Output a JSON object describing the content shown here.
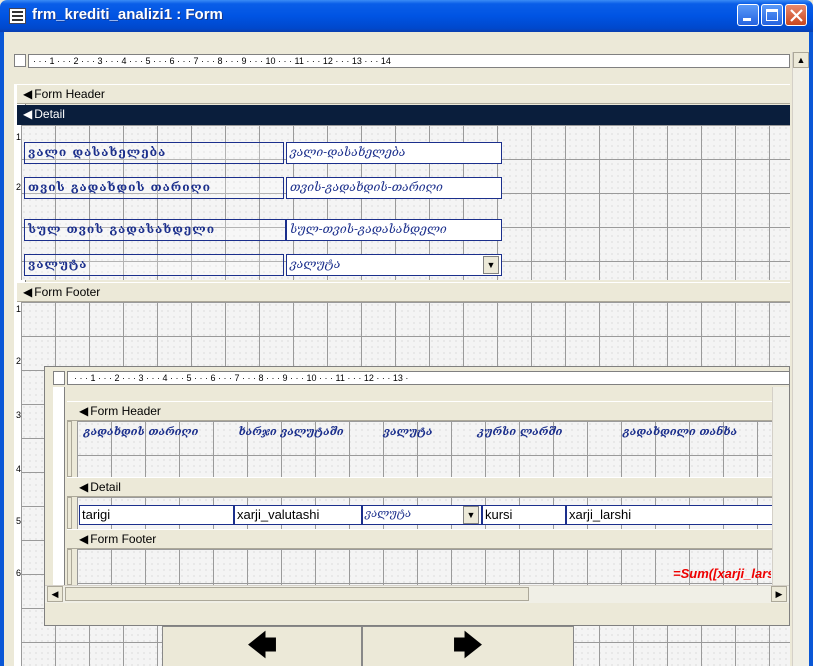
{
  "window": {
    "title": "frm_krediti_analizi1 : Form"
  },
  "ruler": {
    "top_ticks": "· · · 1 · · · 2 · · · 3 · · · 4 · · · 5 · · · 6 · · · 7 · · · 8 · · · 9 · · · 10 · · · 11 · · · 12 · · · 13 · · · 14",
    "sub_ticks": "· · · 1 · · · 2 · · · 3 · · · 4 · · · 5 · · · 6 · · · 7 · · · 8 · · · 9 · · · 10 · · · 11 · · · 12 · · · 13 ·",
    "left_numbers": [
      "1",
      "2",
      "1",
      "2",
      "3",
      "4",
      "5",
      "6"
    ]
  },
  "main_form": {
    "form_header": "Form Header",
    "detail": "Detail",
    "form_footer": "Form Footer",
    "rows": [
      {
        "label": "ვალი დასახელება",
        "value": "ვალი-დასახელება"
      },
      {
        "label": "თვის გადახდის თარიღი",
        "value": "თვის-გადახდის-თარიღი"
      },
      {
        "label": "სულ თვის გადასახდელი",
        "value": "სულ-თვის-გადასახდელი"
      },
      {
        "label": "ვალუტა",
        "value": "ვალუტა"
      }
    ]
  },
  "subform": {
    "form_header": "Form Header",
    "detail": "Detail",
    "form_footer": "Form Footer",
    "headers": [
      "გადახდის თარიღი",
      "ხარჯი ვალუტაში",
      "ვალუტა",
      "კურსი ლარში",
      "გადახდილი თანხა"
    ],
    "fields": [
      "tarigi",
      "xarji_valutashi",
      "ვალუტა",
      "kursi",
      "xarji_larshi"
    ],
    "sum_expr": "=Sum([xarji_larshi])"
  },
  "nav": {
    "prev_icon": "arrow-left-icon",
    "next_icon": "arrow-right-icon"
  }
}
